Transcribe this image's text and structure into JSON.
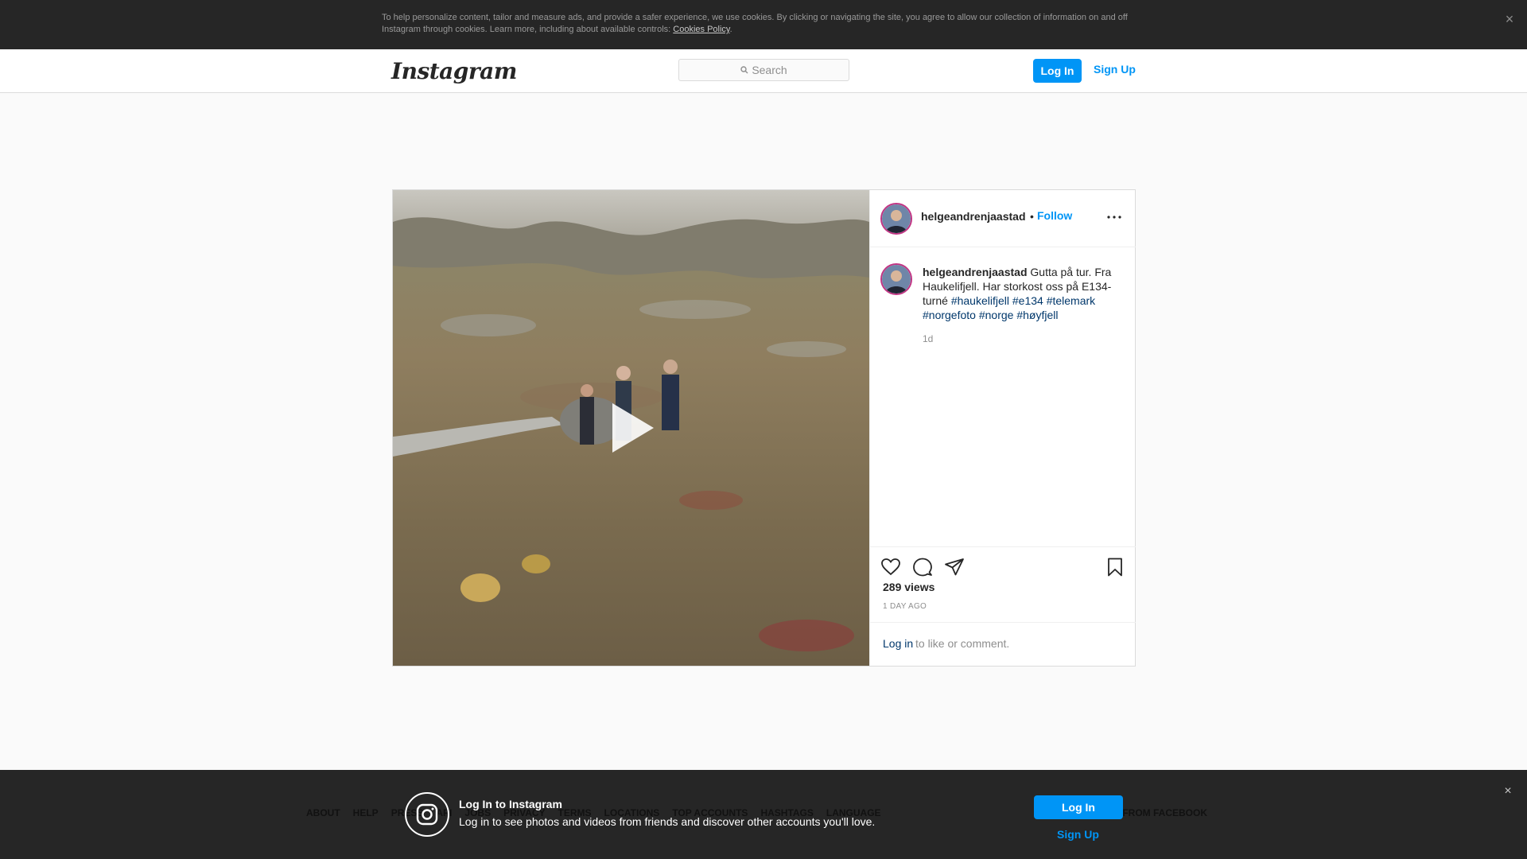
{
  "cookie_banner": {
    "text": "To help personalize content, tailor and measure ads, and provide a safer experience, we use cookies. By clicking or navigating the site, you agree to allow our collection of information on and off Instagram through cookies. Learn more, including about available controls:",
    "link": "Cookies Policy",
    "suffix": ".",
    "close_icon": "close-icon",
    "close_glyph": "×"
  },
  "nav": {
    "logo": "Instagram",
    "search_placeholder": "Search",
    "login_label": "Log In",
    "signup_label": "Sign Up"
  },
  "post": {
    "username": "helgeandrenjaastad",
    "dot": "•",
    "follow_label": "Follow",
    "caption_text": " Gutta på tur. Fra Haukelifjell. Har storkost oss på E134-turné ",
    "hashtags": [
      "#haukelifjell",
      "#e134",
      "#telemark",
      "#norgefoto",
      "#norge",
      "#høyfjell"
    ],
    "caption_age": "1d",
    "views": "289 views",
    "posted": "1 DAY AGO",
    "login_link": "Log in",
    "login_rest": "to like or comment.",
    "icons": [
      "play-icon",
      "more-icon",
      "heart-icon",
      "comment-icon",
      "share-icon",
      "bookmark-icon"
    ]
  },
  "footer": {
    "links": [
      "ABOUT",
      "HELP",
      "PRESS",
      "API",
      "JOBS",
      "PRIVACY",
      "TERMS",
      "LOCATIONS",
      "TOP ACCOUNTS",
      "HASHTAGS",
      "LANGUAGE"
    ],
    "right_text": "M FROM FACEBOOK"
  },
  "login_banner": {
    "title": "Log In to Instagram",
    "subtitle": "Log in to see photos and videos from friends and discover other accounts you'll love.",
    "login_label": "Log In",
    "signup_label": "Sign Up",
    "close_glyph": "×"
  },
  "colors": {
    "accent": "#0095f6",
    "link_dark": "#00376b",
    "banner_bg": "#262626"
  }
}
